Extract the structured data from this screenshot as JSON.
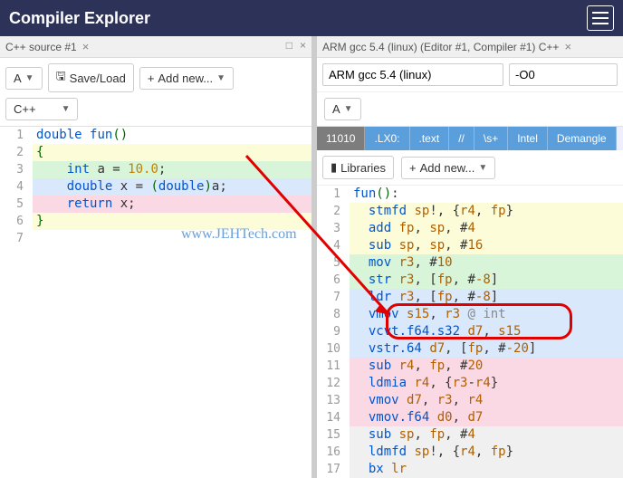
{
  "header": {
    "title": "Compiler Explorer"
  },
  "left": {
    "tab": "C++ source #1",
    "font_label": "A",
    "save_label": "Save/Load",
    "addnew_label": "Add new...",
    "lang_label": "C++",
    "lines": [
      {
        "n": "1",
        "cls": "",
        "html": "<span class='kw'>double</span> <span class='fn'>fun</span><span class='paren'>()</span>"
      },
      {
        "n": "2",
        "cls": "hl-yellow",
        "html": "<span class='paren'>{</span>"
      },
      {
        "n": "3",
        "cls": "hl-green",
        "html": "    <span class='kw'>int</span> a = <span class='num'>10.0</span>;"
      },
      {
        "n": "4",
        "cls": "hl-blue",
        "html": "    <span class='kw'>double</span> x = <span class='paren'>(</span><span class='kw'>double</span><span class='paren'>)</span>a;"
      },
      {
        "n": "5",
        "cls": "hl-pink",
        "html": "    <span class='kw'>return</span> x;"
      },
      {
        "n": "6",
        "cls": "hl-yellow",
        "html": "<span class='paren'>}</span>"
      },
      {
        "n": "7",
        "cls": "",
        "html": ""
      }
    ]
  },
  "right": {
    "tab": "ARM gcc 5.4 (linux) (Editor #1, Compiler #1) C++",
    "compiler": "ARM gcc 5.4 (linux)",
    "opts": "-O0",
    "font_label": "A",
    "chips": [
      "11010",
      ".LX0:",
      ".text",
      "//",
      "\\s+",
      "Intel",
      "Demangle"
    ],
    "libraries_label": "Libraries",
    "addnew_label": "Add new...",
    "lines": [
      {
        "n": "1",
        "cls": "",
        "html": "<span class='fn'>fun</span><span class='paren'>()</span>:"
      },
      {
        "n": "2",
        "cls": "hl-yellow",
        "html": "  <span class='asmop'>stmfd</span> <span class='asmreg'>sp</span>!, {<span class='asmreg'>r4</span>, <span class='asmreg'>fp</span>}"
      },
      {
        "n": "3",
        "cls": "hl-yellow",
        "html": "  <span class='asmop'>add</span> <span class='asmreg'>fp</span>, <span class='asmreg'>sp</span>, #<span class='asmnum'>4</span>"
      },
      {
        "n": "4",
        "cls": "hl-yellow",
        "html": "  <span class='asmop'>sub</span> <span class='asmreg'>sp</span>, <span class='asmreg'>sp</span>, #<span class='asmnum'>16</span>"
      },
      {
        "n": "5",
        "cls": "hl-green",
        "html": "  <span class='asmop'>mov</span> <span class='asmreg'>r3</span>, #<span class='asmnum'>10</span>"
      },
      {
        "n": "6",
        "cls": "hl-green",
        "html": "  <span class='asmop'>str</span> <span class='asmreg'>r3</span>, [<span class='asmreg'>fp</span>, #<span class='asmnum'>-8</span>]"
      },
      {
        "n": "7",
        "cls": "hl-blue",
        "html": "  <span class='asmop'>ldr</span> <span class='asmreg'>r3</span>, [<span class='asmreg'>fp</span>, #<span class='asmnum'>-8</span>]"
      },
      {
        "n": "8",
        "cls": "hl-blue",
        "html": "  <span class='asmop'>vmov</span> <span class='asmreg'>s15</span>, <span class='asmreg'>r3</span> <span class='asmcom'>@ int</span>"
      },
      {
        "n": "9",
        "cls": "hl-blue",
        "html": "  <span class='asmop'>vcvt.f64.s32</span> <span class='asmreg'>d7</span>, <span class='asmreg'>s15</span>"
      },
      {
        "n": "10",
        "cls": "hl-blue",
        "html": "  <span class='asmop'>vstr.64</span> <span class='asmreg'>d7</span>, [<span class='asmreg'>fp</span>, #<span class='asmnum'>-20</span>]"
      },
      {
        "n": "11",
        "cls": "hl-pink",
        "html": "  <span class='asmop'>sub</span> <span class='asmreg'>r4</span>, <span class='asmreg'>fp</span>, #<span class='asmnum'>20</span>"
      },
      {
        "n": "12",
        "cls": "hl-pink",
        "html": "  <span class='asmop'>ldmia</span> <span class='asmreg'>r4</span>, {<span class='asmreg'>r3</span>-<span class='asmreg'>r4</span>}"
      },
      {
        "n": "13",
        "cls": "hl-pink",
        "html": "  <span class='asmop'>vmov</span> <span class='asmreg'>d7</span>, <span class='asmreg'>r3</span>, <span class='asmreg'>r4</span>"
      },
      {
        "n": "14",
        "cls": "hl-pink",
        "html": "  <span class='asmop'>vmov.f64</span> <span class='asmreg'>d0</span>, <span class='asmreg'>d7</span>"
      },
      {
        "n": "15",
        "cls": "hl-grey",
        "html": "  <span class='asmop'>sub</span> <span class='asmreg'>sp</span>, <span class='asmreg'>fp</span>, #<span class='asmnum'>4</span>"
      },
      {
        "n": "16",
        "cls": "hl-grey",
        "html": "  <span class='asmop'>ldmfd</span> <span class='asmreg'>sp</span>!, {<span class='asmreg'>r4</span>, <span class='asmreg'>fp</span>}"
      },
      {
        "n": "17",
        "cls": "hl-grey",
        "html": "  <span class='asmop'>bx</span> <span class='asmreg'>lr</span>"
      }
    ]
  },
  "watermark": "www.JEHTech.com"
}
